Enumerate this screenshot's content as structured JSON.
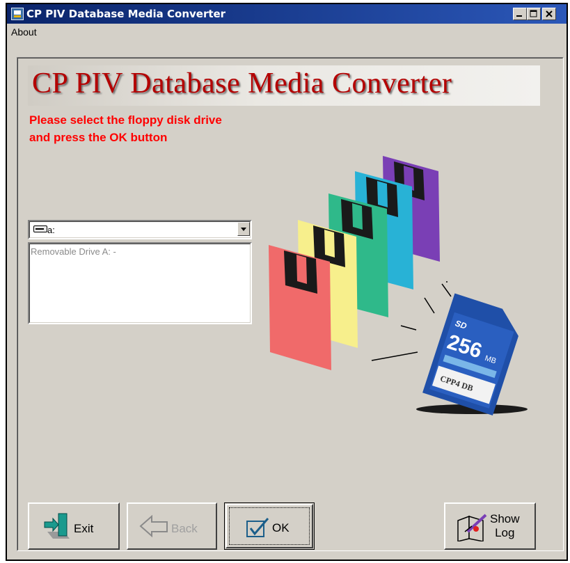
{
  "window": {
    "title": "CP PIV Database Media Converter"
  },
  "menu": {
    "about": "About"
  },
  "banner": {
    "text": "CP PIV Database Media Converter"
  },
  "instruction": {
    "line1": "Please select the floppy disk drive",
    "line2": "and press the OK button"
  },
  "drive_select": {
    "value": "a:"
  },
  "drive_list": {
    "items": [
      "Removable Drive A: -"
    ]
  },
  "illustration": {
    "card_capacity": "256",
    "card_unit": "MB",
    "card_brand": "SD",
    "card_label": "CPP4 DB"
  },
  "buttons": {
    "exit": "Exit",
    "back": "Back",
    "ok": "OK",
    "show_log_line1": "Show",
    "show_log_line2": "Log"
  },
  "colors": {
    "title_bar": "#0a246a",
    "instruction": "#ff0000",
    "banner_text": "#b40000",
    "background": "#d4d0c8"
  }
}
